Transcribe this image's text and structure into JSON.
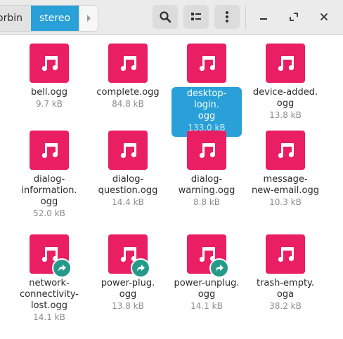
{
  "breadcrumb": {
    "prev": "orbin",
    "current": "stereo"
  },
  "files": [
    {
      "name": "bell.ogg",
      "size": "9.7 kB",
      "link": false,
      "selected": false
    },
    {
      "name": "complete.ogg",
      "size": "84.8 kB",
      "link": false,
      "selected": false
    },
    {
      "name": "desktop-login.ogg",
      "size": "133.0 kB",
      "link": false,
      "selected": true
    },
    {
      "name": "device-added.ogg",
      "size": "13.8 kB",
      "link": false,
      "selected": false
    },
    {
      "name": "dialog-information.ogg",
      "size": "52.0 kB",
      "link": false,
      "selected": false
    },
    {
      "name": "dialog-question.ogg",
      "size": "14.4 kB",
      "link": false,
      "selected": false
    },
    {
      "name": "dialog-warning.ogg",
      "size": "8.8 kB",
      "link": false,
      "selected": false
    },
    {
      "name": "message-new-email.ogg",
      "size": "10.3 kB",
      "link": false,
      "selected": false
    },
    {
      "name": "network-connectivity-lost.ogg",
      "size": "14.1 kB",
      "link": true,
      "selected": false
    },
    {
      "name": "power-plug.ogg",
      "size": "13.8 kB",
      "link": true,
      "selected": false
    },
    {
      "name": "power-unplug.ogg",
      "size": "14.1 kB",
      "link": true,
      "selected": false
    },
    {
      "name": "trash-empty.oga",
      "size": "38.2 kB",
      "link": false,
      "selected": false
    }
  ],
  "display_names": [
    [
      "bell.ogg"
    ],
    [
      "complete.ogg"
    ],
    [
      "desktop-login.",
      "ogg"
    ],
    [
      "device-added.",
      "ogg"
    ],
    [
      "dialog-",
      "information.",
      "ogg"
    ],
    [
      "dialog-",
      "question.ogg"
    ],
    [
      "dialog-",
      "warning.ogg"
    ],
    [
      "message-",
      "new-email.ogg"
    ],
    [
      "network-",
      "connectivity-",
      "lost.ogg"
    ],
    [
      "power-plug.",
      "ogg"
    ],
    [
      "power-unplug.",
      "ogg"
    ],
    [
      "trash-empty.",
      "oga"
    ]
  ],
  "colors": {
    "accent": "#29a0d8",
    "audio_tile": "#e91e63",
    "link_badge": "#259a8a"
  },
  "icons": {
    "file": "music-note-icon",
    "link": "symlink-arrow-icon"
  }
}
